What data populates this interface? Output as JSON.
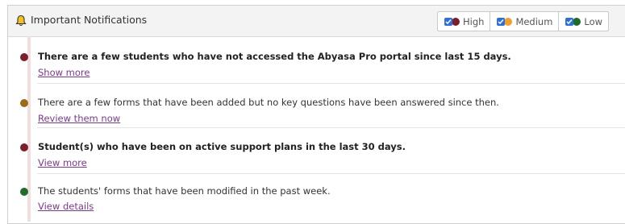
{
  "header": {
    "title": "Important Notifications",
    "filters": [
      {
        "label": "High",
        "color": "#7a1f2b"
      },
      {
        "label": "Medium",
        "color": "#f0a030"
      },
      {
        "label": "Low",
        "color": "#1e6b2a"
      }
    ]
  },
  "notifications": [
    {
      "priority": "High",
      "message": "There are a few students who have not accessed the Abyasa Pro portal since last 15 days.",
      "link": "Show more",
      "bold": true,
      "dot_color": "#7a1f2b"
    },
    {
      "priority": "Medium",
      "message": "There are a few forms that have been added but no key questions have been answered since then.",
      "link": "Review them now",
      "bold": false,
      "dot_color": "#9c6a10"
    },
    {
      "priority": "High",
      "message": "Student(s) who have been on active support plans in the last 30 days.",
      "link": "View more",
      "bold": true,
      "dot_color": "#7a1f2b"
    },
    {
      "priority": "Low",
      "message": "The students' forms that have been modified in the past week.",
      "link": "View details",
      "bold": false,
      "dot_color": "#1e6b2a"
    }
  ]
}
